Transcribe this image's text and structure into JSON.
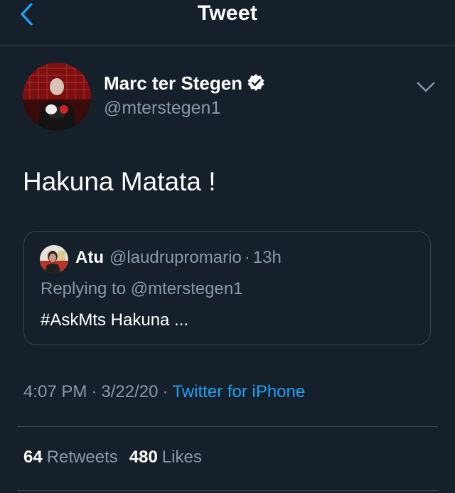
{
  "header": {
    "title": "Tweet",
    "back_icon": "chevron-left-icon",
    "accent": "#1da1f2"
  },
  "tweet": {
    "author_name": "Marc ter Stegen",
    "author_handle": "@mterstegen1",
    "verified_icon": "verified-badge-icon",
    "menu_icon": "chevron-down-icon",
    "text": "Hakuna Matata !",
    "time": "4:07 PM",
    "date": "3/22/20",
    "separator": "·",
    "source": "Twitter for iPhone"
  },
  "quoted": {
    "name": "Atu",
    "handle": "@laudrupromario",
    "separator": "·",
    "time": "13h",
    "replying_to": "Replying to @mterstegen1",
    "text": "#AskMts Hakuna ..."
  },
  "stats": {
    "retweets_count": "64",
    "retweets_label": "Retweets",
    "likes_count": "480",
    "likes_label": "Likes"
  },
  "colors": {
    "background": "#15202b",
    "border": "#38444d",
    "secondary_text": "#8899a6",
    "link": "#1da1f2"
  }
}
